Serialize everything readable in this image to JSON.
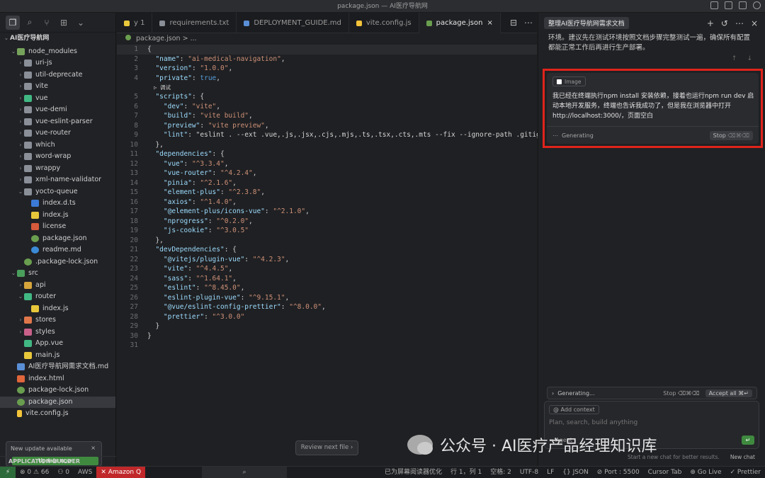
{
  "window": {
    "title": "package.json — AI医疗导航网"
  },
  "sidebar": {
    "project": "AI医疗导航网",
    "tree": [
      {
        "label": "node_modules",
        "depth": 1,
        "open": true,
        "icon": "folder-node"
      },
      {
        "label": "uri-js",
        "depth": 2,
        "open": false,
        "icon": "folder"
      },
      {
        "label": "util-deprecate",
        "depth": 2,
        "open": false,
        "icon": "folder"
      },
      {
        "label": "vite",
        "depth": 2,
        "open": false,
        "icon": "folder"
      },
      {
        "label": "vue",
        "depth": 2,
        "open": false,
        "icon": "folder-vue"
      },
      {
        "label": "vue-demi",
        "depth": 2,
        "open": false,
        "icon": "folder"
      },
      {
        "label": "vue-eslint-parser",
        "depth": 2,
        "open": false,
        "icon": "folder"
      },
      {
        "label": "vue-router",
        "depth": 2,
        "open": false,
        "icon": "folder"
      },
      {
        "label": "which",
        "depth": 2,
        "open": false,
        "icon": "folder"
      },
      {
        "label": "word-wrap",
        "depth": 2,
        "open": false,
        "icon": "folder"
      },
      {
        "label": "wrappy",
        "depth": 2,
        "open": false,
        "icon": "folder"
      },
      {
        "label": "xml-name-validator",
        "depth": 2,
        "open": false,
        "icon": "folder"
      },
      {
        "label": "yocto-queue",
        "depth": 2,
        "open": true,
        "icon": "folder"
      },
      {
        "label": "index.d.ts",
        "depth": 3,
        "icon": "ts"
      },
      {
        "label": "index.js",
        "depth": 3,
        "icon": "js"
      },
      {
        "label": "license",
        "depth": 3,
        "icon": "license"
      },
      {
        "label": "package.json",
        "depth": 3,
        "icon": "json"
      },
      {
        "label": "readme.md",
        "depth": 3,
        "icon": "info"
      },
      {
        "label": ".package-lock.json",
        "depth": 2,
        "icon": "json"
      },
      {
        "label": "src",
        "depth": 1,
        "open": true,
        "icon": "folder-src"
      },
      {
        "label": "api",
        "depth": 2,
        "open": false,
        "icon": "folder-api"
      },
      {
        "label": "router",
        "depth": 2,
        "open": true,
        "icon": "folder-vue"
      },
      {
        "label": "index.js",
        "depth": 3,
        "icon": "js"
      },
      {
        "label": "stores",
        "depth": 2,
        "open": false,
        "icon": "folder-stores"
      },
      {
        "label": "styles",
        "depth": 2,
        "open": false,
        "icon": "folder-styles"
      },
      {
        "label": "App.vue",
        "depth": 2,
        "icon": "vue"
      },
      {
        "label": "main.js",
        "depth": 2,
        "icon": "js"
      },
      {
        "label": "AI医疗导航网需求文档.md",
        "depth": 1,
        "icon": "md"
      },
      {
        "label": "index.html",
        "depth": 1,
        "icon": "html"
      },
      {
        "label": "package-lock.json",
        "depth": 1,
        "icon": "json"
      },
      {
        "label": "package.json",
        "depth": 1,
        "icon": "json",
        "selected": true
      },
      {
        "label": "vite.config.js",
        "depth": 1,
        "icon": "vite"
      }
    ],
    "update": {
      "title": "New update available",
      "button": "Update now",
      "close": "×"
    },
    "app_builder": "APPLICATION BUILDER"
  },
  "tabs": [
    {
      "label": "y 1",
      "icon_color": "#e8c83b"
    },
    {
      "label": "requirements.txt",
      "icon_color": "#8a8f98"
    },
    {
      "label": "DEPLOYMENT_GUIDE.md",
      "icon_color": "#5a8fd6"
    },
    {
      "label": "vite.config.js",
      "icon_color": "#f3c43a"
    },
    {
      "label": "package.json",
      "icon_color": "#6a9e4f",
      "active": true
    }
  ],
  "breadcrumb": {
    "file": "package.json",
    "sep": ">",
    "rest": "..."
  },
  "code": [
    {
      "n": "1",
      "t": "{"
    },
    {
      "n": "2",
      "t": "  \"name\": \"ai-medical-navigation\","
    },
    {
      "n": "3",
      "t": "  \"version\": \"1.0.0\","
    },
    {
      "n": "4",
      "t": "  \"private\": true,"
    },
    {
      "n": "",
      "t": "  ▷ 调试",
      "lens": true
    },
    {
      "n": "5",
      "t": "  \"scripts\": {"
    },
    {
      "n": "6",
      "t": "    \"dev\": \"vite\","
    },
    {
      "n": "7",
      "t": "    \"build\": \"vite build\","
    },
    {
      "n": "8",
      "t": "    \"preview\": \"vite preview\","
    },
    {
      "n": "9",
      "t": "    \"lint\": \"eslint . --ext .vue,.js,.jsx,.cjs,.mjs,.ts,.tsx,.cts,.mts --fix --ignore-path .gitignore"
    },
    {
      "n": "10",
      "t": "  },"
    },
    {
      "n": "11",
      "t": "  \"dependencies\": {"
    },
    {
      "n": "12",
      "t": "    \"vue\": \"^3.3.4\","
    },
    {
      "n": "13",
      "t": "    \"vue-router\": \"^4.2.4\","
    },
    {
      "n": "14",
      "t": "    \"pinia\": \"^2.1.6\","
    },
    {
      "n": "15",
      "t": "    \"element-plus\": \"^2.3.8\","
    },
    {
      "n": "16",
      "t": "    \"axios\": \"^1.4.0\","
    },
    {
      "n": "17",
      "t": "    \"@element-plus/icons-vue\": \"^2.1.0\","
    },
    {
      "n": "18",
      "t": "    \"nprogress\": \"^0.2.0\","
    },
    {
      "n": "19",
      "t": "    \"js-cookie\": \"^3.0.5\""
    },
    {
      "n": "20",
      "t": "  },"
    },
    {
      "n": "21",
      "t": "  \"devDependencies\": {"
    },
    {
      "n": "22",
      "t": "    \"@vitejs/plugin-vue\": \"^4.2.3\","
    },
    {
      "n": "23",
      "t": "    \"vite\": \"^4.4.5\","
    },
    {
      "n": "24",
      "t": "    \"sass\": \"^1.64.1\","
    },
    {
      "n": "25",
      "t": "    \"eslint\": \"^8.45.0\","
    },
    {
      "n": "26",
      "t": "    \"eslint-plugin-vue\": \"^9.15.1\","
    },
    {
      "n": "27",
      "t": "    \"@vue/eslint-config-prettier\": \"^8.0.0\","
    },
    {
      "n": "28",
      "t": "    \"prettier\": \"^3.0.0\""
    },
    {
      "n": "29",
      "t": "  }"
    },
    {
      "n": "30",
      "t": "}"
    },
    {
      "n": "31",
      "t": ""
    }
  ],
  "review_next": "Review next file  ›",
  "chat": {
    "title": "整理AI医疗导航网需求文档",
    "prev_text": "环境。建议先在测试环境按照文档步骤完整测试一遍，确保所有配置都能正常工作后再进行生产部署。",
    "image_chip": "Image",
    "message": "我已经在终端执行npm install 安装依赖，接着也运行npm run dev 启动本地开发服务，终端也告诉我成功了，但是我在浏览器中打开http://localhost:3000/，页面空白",
    "generating": "Generating",
    "stop": "Stop",
    "stop_kb": "⌫⌘⌫",
    "gen_bar": "Generating...",
    "gen_bar_stop": "Stop ⌫⌘⌫",
    "accept_all": "Accept all ⌘↵",
    "add_context": "@ Add context",
    "input_placeholder": "Plan, search, build anything",
    "mode": "∞ Agent",
    "hint": "Start a new chat for better results.",
    "new_chat": "New chat"
  },
  "watermark": "公众号 · AI医疗产品经理知识库",
  "status": {
    "problems": "⊗ 0 ⚠ 66",
    "ports": "⚇ 0",
    "aws": "AWS",
    "amazonq": "✕ Amazon Q",
    "screen_reader": "已为屏幕阅读器优化",
    "position": "行 1，列 1",
    "spaces": "空格: 2",
    "encoding": "UTF-8",
    "eol": "LF",
    "language": "{} JSON",
    "port": "⊘ Port : 5500",
    "cursor_tab": "Cursor Tab",
    "golive": "⊕ Go Live",
    "prettier": "✓ Prettier"
  }
}
